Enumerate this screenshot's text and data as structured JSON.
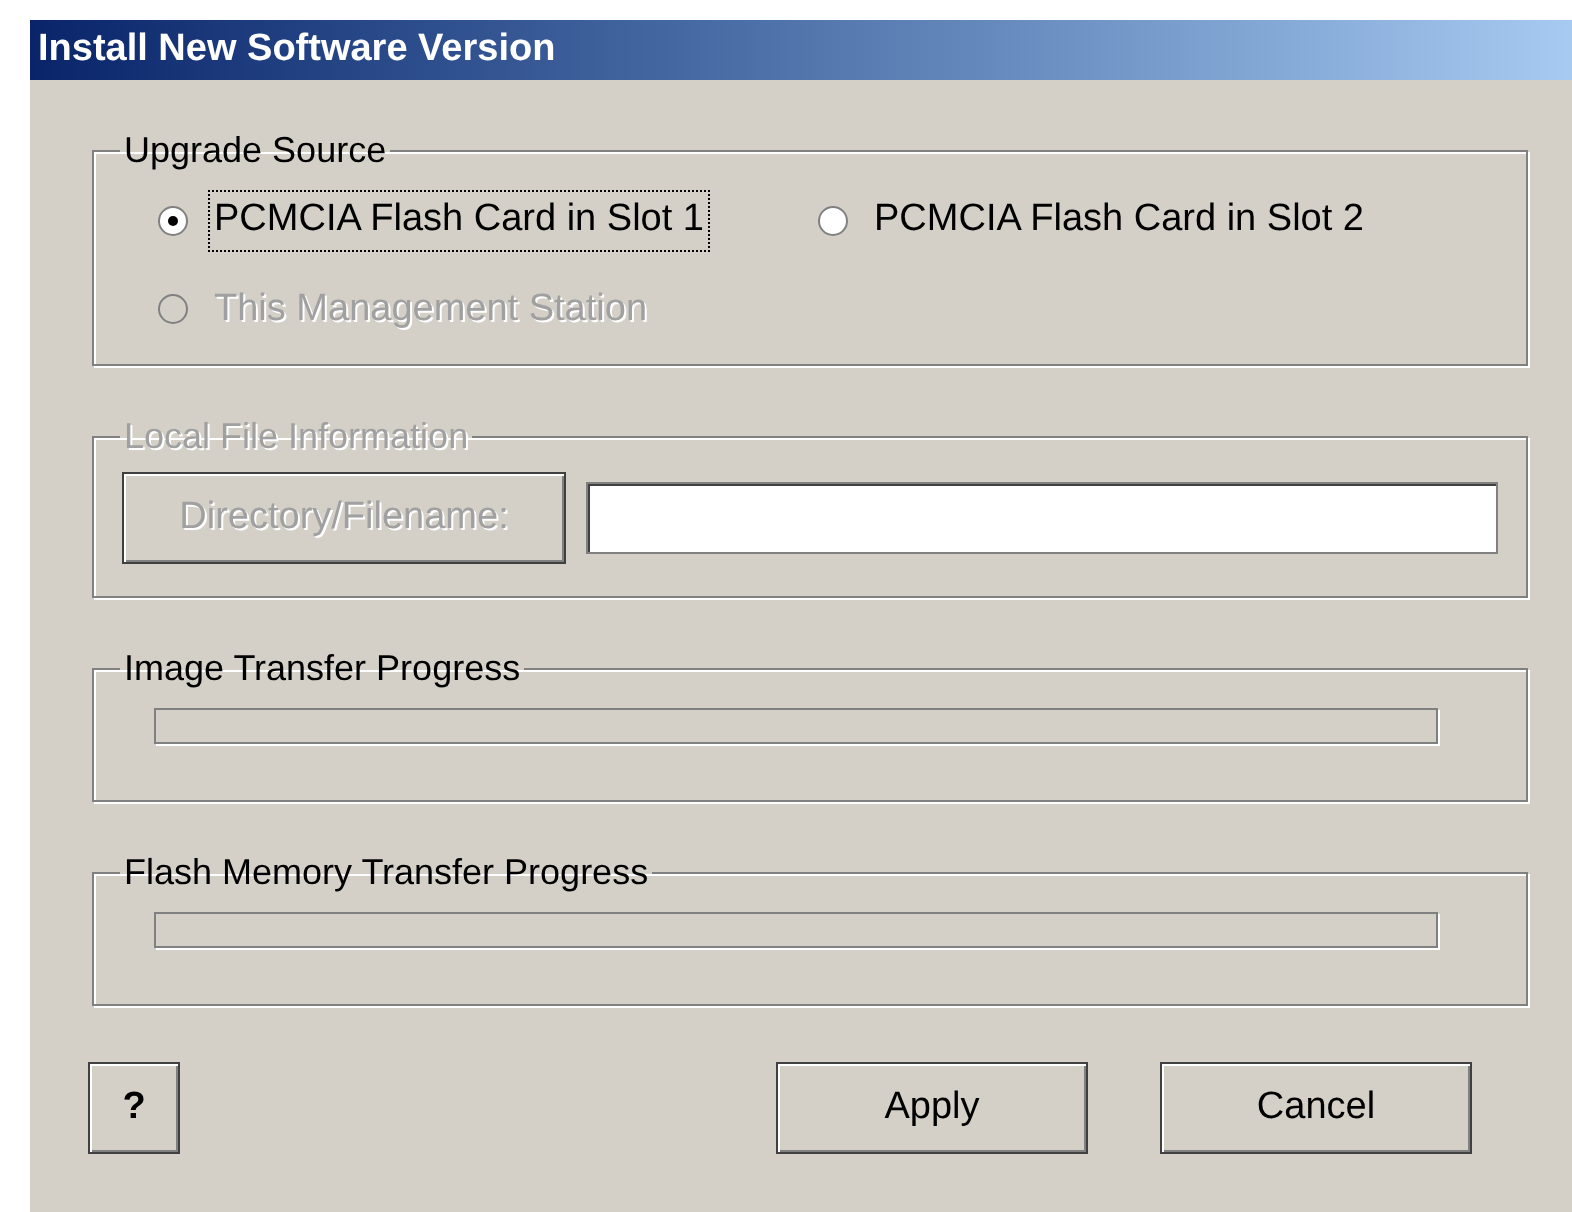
{
  "window": {
    "title": "Install New Software Version"
  },
  "upgrade_source": {
    "title": "Upgrade Source",
    "options": [
      {
        "label": "PCMCIA Flash Card in Slot 1",
        "selected": true,
        "disabled": false,
        "focused": true
      },
      {
        "label": "PCMCIA Flash Card in Slot 2",
        "selected": false,
        "disabled": false,
        "focused": false
      },
      {
        "label": "This Management Station",
        "selected": false,
        "disabled": true,
        "focused": false
      }
    ]
  },
  "local_file": {
    "title": "Local File Information",
    "disabled": true,
    "button": "Directory/Filename:"
  },
  "progress": [
    {
      "title": "Image Transfer Progress",
      "level": 0
    },
    {
      "title": "Flash Memory Transfer Progress",
      "level": 0
    }
  ],
  "buttons": {
    "help": "?",
    "apply": "Apply",
    "cancel": "Cancel"
  }
}
